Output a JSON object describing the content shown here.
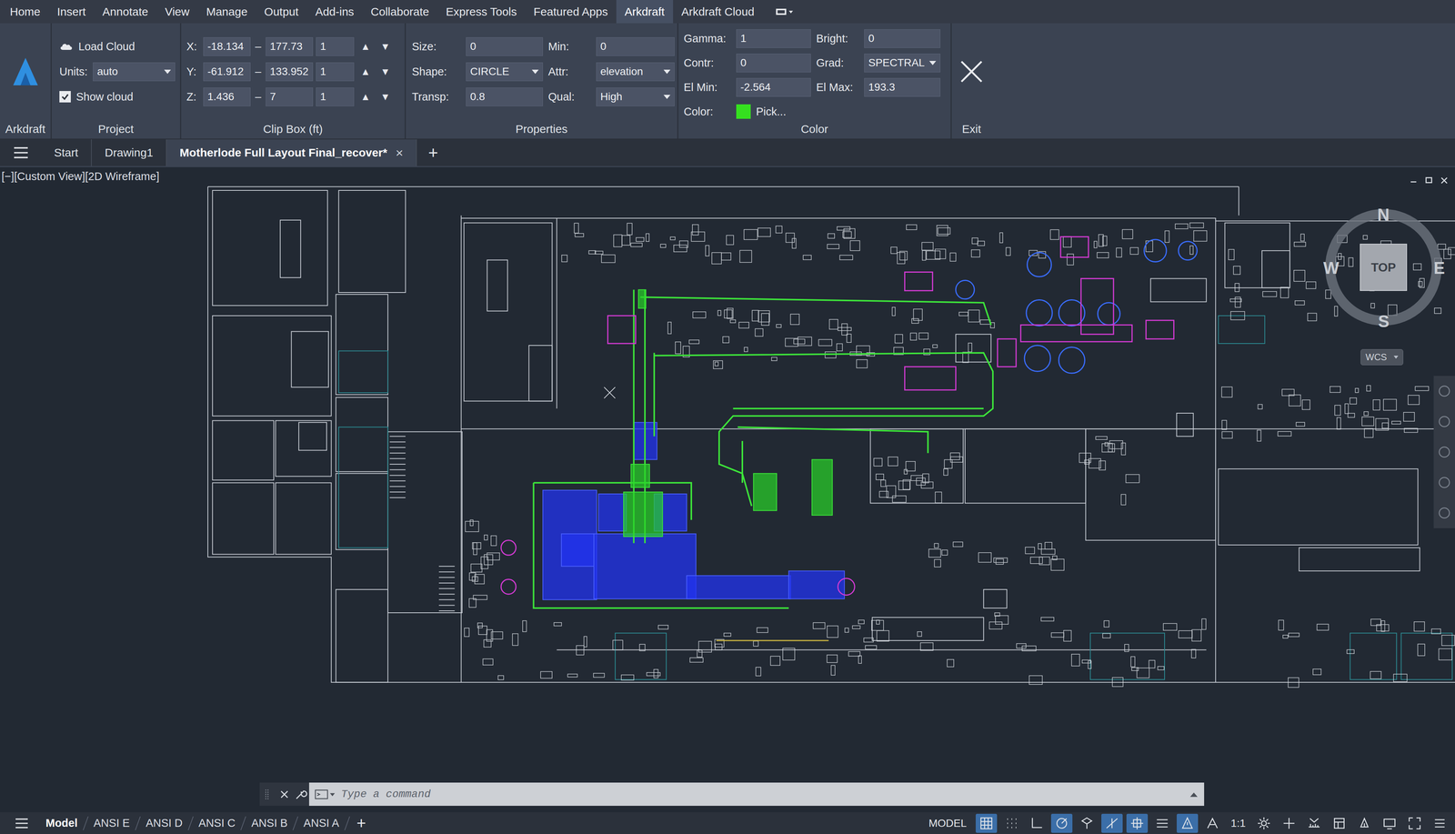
{
  "menu": [
    {
      "label": "Home",
      "selected": false
    },
    {
      "label": "Insert",
      "selected": false
    },
    {
      "label": "Annotate",
      "selected": false
    },
    {
      "label": "View",
      "selected": false
    },
    {
      "label": "Manage",
      "selected": false
    },
    {
      "label": "Output",
      "selected": false
    },
    {
      "label": "Add-ins",
      "selected": false
    },
    {
      "label": "Collaborate",
      "selected": false
    },
    {
      "label": "Express Tools",
      "selected": false
    },
    {
      "label": "Featured Apps",
      "selected": false
    },
    {
      "label": "Arkdraft",
      "selected": true
    },
    {
      "label": "Arkdraft Cloud",
      "selected": false
    }
  ],
  "ribbon": {
    "arkdraft": {
      "label": "Arkdraft"
    },
    "project": {
      "label": "Project",
      "load_cloud": "Load Cloud",
      "units_label": "Units:",
      "units_value": "auto",
      "show_cloud": {
        "label": "Show cloud",
        "checked": true
      }
    },
    "clip_box": {
      "label": "Clip Box (ft)",
      "rows": [
        {
          "axis": "X:",
          "min": "-18.134",
          "dash": "–",
          "max": "177.73",
          "step": "1",
          "up": "▲",
          "down": "▼"
        },
        {
          "axis": "Y:",
          "min": "-61.912",
          "dash": "–",
          "max": "133.952",
          "step": "1",
          "up": "▲",
          "down": "▼"
        },
        {
          "axis": "Z:",
          "min": "1.436",
          "dash": "–",
          "max": "7",
          "step": "1",
          "up": "▲",
          "down": "▼"
        }
      ]
    },
    "properties": {
      "label": "Properties",
      "fields": [
        {
          "label": "Size:",
          "value": "0",
          "kind": "input"
        },
        {
          "label": "Min:",
          "value": "0",
          "kind": "input"
        },
        {
          "label": "Shape:",
          "value": "CIRCLE",
          "kind": "select"
        },
        {
          "label": "Attr:",
          "value": "elevation",
          "kind": "select"
        },
        {
          "label": "Transp:",
          "value": "0.8",
          "kind": "input"
        },
        {
          "label": "Qual:",
          "value": "High",
          "kind": "select"
        }
      ]
    },
    "color": {
      "label": "Color",
      "fields": [
        {
          "label": "Gamma:",
          "value": "1",
          "kind": "input"
        },
        {
          "label": "Bright:",
          "value": "0",
          "kind": "input"
        },
        {
          "label": "Contr:",
          "value": "0",
          "kind": "input"
        },
        {
          "label": "Grad:",
          "value": "SPECTRAL",
          "kind": "select"
        },
        {
          "label": "El Min:",
          "value": "-2.564",
          "kind": "input"
        },
        {
          "label": "El Max:",
          "value": "193.3",
          "kind": "input"
        }
      ],
      "pick": {
        "label": "Color:",
        "swatch": "#35e01f",
        "text": "Pick..."
      }
    },
    "exit": {
      "label": "Exit"
    }
  },
  "file_tabs": {
    "items": [
      {
        "label": "Start",
        "selected": false,
        "closable": false
      },
      {
        "label": "Drawing1",
        "selected": false,
        "closable": false
      },
      {
        "label": "Motherlode Full Layout Final_recover*",
        "selected": true,
        "closable": true
      }
    ],
    "close": "×",
    "add": "+"
  },
  "viewport": {
    "label": "[−][Custom View][2D Wireframe]",
    "viewcube": {
      "north": "N",
      "south": "S",
      "east": "E",
      "west": "W",
      "face": "TOP",
      "ucs": "WCS"
    }
  },
  "command_line": {
    "placeholder": "Type a command"
  },
  "layout_tabs": {
    "items": [
      {
        "label": "Model",
        "selected": true
      },
      {
        "label": "ANSI E",
        "selected": false
      },
      {
        "label": "ANSI D",
        "selected": false
      },
      {
        "label": "ANSI C",
        "selected": false
      },
      {
        "label": "ANSI B",
        "selected": false
      },
      {
        "label": "ANSI A",
        "selected": false
      }
    ],
    "add": "+"
  },
  "status_bar": {
    "space": "MODEL",
    "scale": "1:1",
    "toggles": [
      {
        "active": true
      },
      {
        "active": false
      },
      {
        "active": false
      },
      {
        "active": true
      },
      {
        "active": false
      },
      {
        "active": true
      },
      {
        "active": true
      },
      {
        "active": false
      },
      {
        "active": true
      },
      {
        "active": false
      },
      {
        "active": false
      },
      {
        "active": false
      },
      {
        "active": false
      },
      {
        "active": false
      },
      {
        "active": false
      },
      {
        "active": false
      },
      {
        "active": false
      },
      {
        "active": false
      }
    ]
  }
}
